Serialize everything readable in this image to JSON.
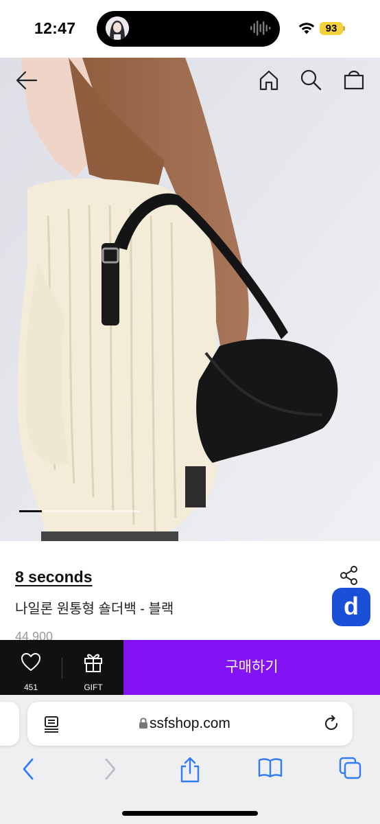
{
  "status_bar": {
    "time": "12:47",
    "battery": "93"
  },
  "product": {
    "brand": "8 seconds",
    "name": "나일론 원통형 숄더백 - 블랙",
    "price": "44,900",
    "image_progress": 0.19
  },
  "actions": {
    "like_count": "451",
    "gift_label": "GIFT",
    "buy_label": "구매하기"
  },
  "browser": {
    "url": "ssfshop.com"
  },
  "colors": {
    "buy_button": "#8312f5",
    "action_bar_dark": "#111111",
    "app_badge": "#1a4fd8",
    "battery": "#f3d23b",
    "safari_tint": "#2f7cf6"
  }
}
